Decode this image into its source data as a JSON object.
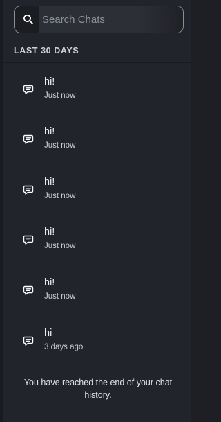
{
  "search": {
    "placeholder": "Search Chats",
    "icon": "search-icon"
  },
  "section": {
    "header": "LAST 30 DAYS"
  },
  "chats": [
    {
      "title": "hi!",
      "time": "Just now",
      "icon": "chat-bubble-icon"
    },
    {
      "title": "hi!",
      "time": "Just now",
      "icon": "chat-bubble-icon"
    },
    {
      "title": "hi!",
      "time": "Just now",
      "icon": "chat-bubble-icon"
    },
    {
      "title": "hi!",
      "time": "Just now",
      "icon": "chat-bubble-icon"
    },
    {
      "title": "hi!",
      "time": "Just now",
      "icon": "chat-bubble-icon"
    },
    {
      "title": "hi",
      "time": "3 days ago",
      "icon": "chat-bubble-icon"
    }
  ],
  "footer": {
    "end_message": "You have reached the end of your chat history."
  },
  "colors": {
    "background": "#21242b",
    "text": "#e8eaee",
    "muted": "#8d919a"
  }
}
